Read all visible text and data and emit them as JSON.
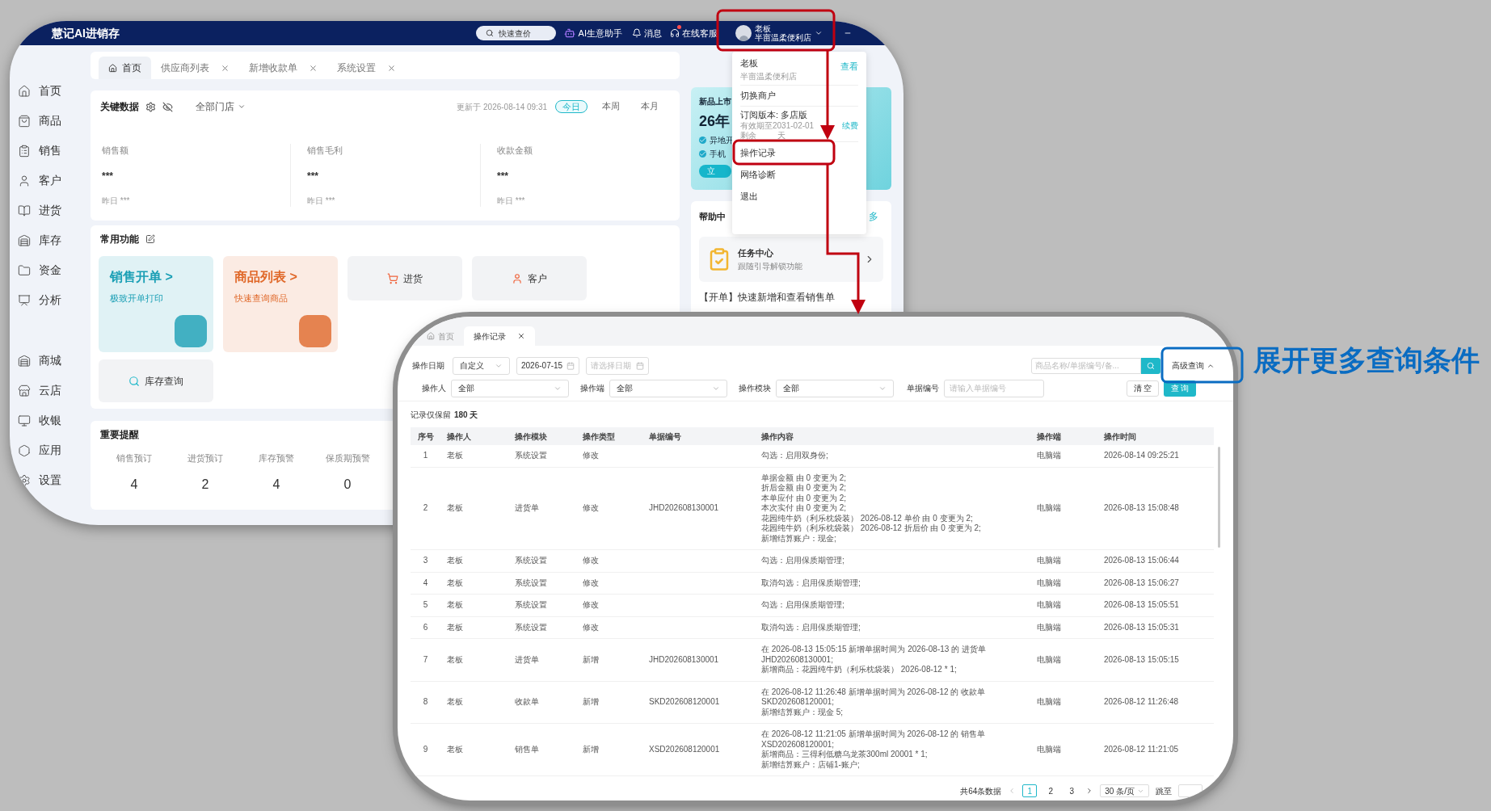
{
  "top_window": {
    "header": {
      "logo": "慧记AI进销存",
      "quick_price": "快速查价",
      "ai_assistant": "AI生意助手",
      "messages": "消息",
      "support": "在线客服",
      "support_notice": true,
      "user_name": "老板",
      "user_shop": "半亩温柔便利店"
    },
    "sidebar_main": [
      {
        "label": "首页"
      },
      {
        "label": "商品"
      },
      {
        "label": "销售"
      },
      {
        "label": "客户"
      },
      {
        "label": "进货"
      },
      {
        "label": "库存"
      },
      {
        "label": "资金"
      },
      {
        "label": "分析"
      }
    ],
    "sidebar_more": [
      {
        "label": "商城"
      },
      {
        "label": "云店"
      },
      {
        "label": "收银"
      },
      {
        "label": "应用"
      },
      {
        "label": "设置"
      }
    ],
    "tabs": [
      {
        "label": "首页",
        "selected": true,
        "closable": false
      },
      {
        "label": "供应商列表",
        "selected": false,
        "closable": true
      },
      {
        "label": "新增收款单",
        "selected": false,
        "closable": true
      },
      {
        "label": "系统设置",
        "selected": false,
        "closable": true
      }
    ],
    "key_data": {
      "title": "关键数据",
      "store": "全部门店",
      "updated": "更新于 2026-08-14 09:31",
      "periods": [
        {
          "label": "今日",
          "selected": true
        },
        {
          "label": "本周",
          "selected": false
        },
        {
          "label": "本月",
          "selected": false
        }
      ],
      "metrics": [
        {
          "label": "销售额",
          "value": "***",
          "yesterday": "昨日 ***"
        },
        {
          "label": "销售毛利",
          "value": "***",
          "yesterday": "昨日 ***"
        },
        {
          "label": "收款金额",
          "value": "***",
          "yesterday": "昨日 ***"
        }
      ]
    },
    "common_functions": {
      "title": "常用功能",
      "features": [
        {
          "kind": "banner",
          "title": "销售开单 >",
          "subtitle": "极致开单打印",
          "color": "#1a9fb5"
        },
        {
          "kind": "banner",
          "title": "商品列表 >",
          "subtitle": "快速查询商品",
          "color": "#e0692a"
        },
        {
          "kind": "tile",
          "label": "进货"
        },
        {
          "kind": "tile",
          "label": "客户"
        },
        {
          "kind": "tile",
          "label": "库存查询"
        }
      ]
    },
    "reminders": {
      "title": "重要提醒",
      "items": [
        {
          "label": "销售预订",
          "count": "4"
        },
        {
          "label": "进货预订",
          "count": "2"
        },
        {
          "label": "库存预警",
          "count": "4"
        },
        {
          "label": "保质期预警",
          "count": "0"
        }
      ]
    },
    "promo": {
      "title": "新品上市",
      "headline": "26年",
      "points": [
        "异地开",
        "手机"
      ],
      "button": "立"
    },
    "help": {
      "title": "帮助中",
      "more": "多",
      "task_title": "任务中心",
      "task_subtitle": "跟随引导解锁功能",
      "article": "【开单】快速新增和查看销售单"
    },
    "user_menu": {
      "name": "老板",
      "shop": "半亩温柔便利店",
      "view": "查看",
      "switch": "切换商户",
      "plan": "订阅版本: 多店版",
      "expiry": "有效期至2031-02-01",
      "renew": "续费",
      "remaining_prefix": "剩余",
      "remaining_suffix": "天",
      "items": [
        "操作记录",
        "网络诊断",
        "退出"
      ]
    }
  },
  "bottom_window": {
    "tabs": [
      {
        "label": "首页",
        "selected": false,
        "closable": false
      },
      {
        "label": "操作记录",
        "selected": true,
        "closable": true
      }
    ],
    "filters": {
      "date_label": "操作日期",
      "date_mode": "自定义",
      "date_start": "2026-07-15",
      "date_end_placeholder": "请选择日期",
      "search_placeholder": "商品名称/单据编号/备...",
      "advanced": "高级查询",
      "advanced_expanded": true,
      "operator_label": "操作人",
      "operator": "全部",
      "terminal_label": "操作端",
      "terminal": "全部",
      "module_label": "操作模块",
      "module": "全部",
      "doc_label": "单据编号",
      "doc_placeholder": "请输入单据编号",
      "clear": "清 空",
      "query": "查 询"
    },
    "note_prefix": "记录仅保留",
    "note_days": "180 天",
    "table": {
      "columns": [
        "序号",
        "操作人",
        "操作模块",
        "操作类型",
        "单据编号",
        "操作内容",
        "操作端",
        "操作时间"
      ],
      "rows": [
        {
          "no": "1",
          "operator": "老板",
          "module": "系统设置",
          "type": "修改",
          "doc": "",
          "content": [
            "勾选：启用双身份;"
          ],
          "terminal": "电脑端",
          "time": "2026-08-14 09:25:21"
        },
        {
          "no": "2",
          "operator": "老板",
          "module": "进货单",
          "type": "修改",
          "doc": "JHD202608130001",
          "content": [
            "单据金额 由 0 变更为 2;",
            "折后金额 由 0 变更为 2;",
            "本单应付 由 0 变更为 2;",
            "本次实付 由 0 变更为 2;",
            "花园纯牛奶（利乐枕袋装） 2026-08-12 单价 由 0 变更为 2;",
            "花园纯牛奶（利乐枕袋装） 2026-08-12 折后价 由 0 变更为 2;",
            "新增结算账户：现金;"
          ],
          "terminal": "电脑端",
          "time": "2026-08-13 15:08:48"
        },
        {
          "no": "3",
          "operator": "老板",
          "module": "系统设置",
          "type": "修改",
          "doc": "",
          "content": [
            "勾选：启用保质期管理;"
          ],
          "terminal": "电脑端",
          "time": "2026-08-13 15:06:44"
        },
        {
          "no": "4",
          "operator": "老板",
          "module": "系统设置",
          "type": "修改",
          "doc": "",
          "content": [
            "取消勾选：启用保质期管理;"
          ],
          "terminal": "电脑端",
          "time": "2026-08-13 15:06:27"
        },
        {
          "no": "5",
          "operator": "老板",
          "module": "系统设置",
          "type": "修改",
          "doc": "",
          "content": [
            "勾选：启用保质期管理;"
          ],
          "terminal": "电脑端",
          "time": "2026-08-13 15:05:51"
        },
        {
          "no": "6",
          "operator": "老板",
          "module": "系统设置",
          "type": "修改",
          "doc": "",
          "content": [
            "取消勾选：启用保质期管理;"
          ],
          "terminal": "电脑端",
          "time": "2026-08-13 15:05:31"
        },
        {
          "no": "7",
          "operator": "老板",
          "module": "进货单",
          "type": "新增",
          "doc": "JHD202608130001",
          "content": [
            "在 2026-08-13 15:05:15 新增单据时间为 2026-08-13 的 进货单 JHD202608130001;",
            "新增商品：花园纯牛奶（利乐枕袋装） 2026-08-12 * 1;"
          ],
          "terminal": "电脑端",
          "time": "2026-08-13 15:05:15"
        },
        {
          "no": "8",
          "operator": "老板",
          "module": "收款单",
          "type": "新增",
          "doc": "SKD202608120001",
          "content": [
            "在 2026-08-12 11:26:48 新增单据时间为 2026-08-12 的 收款单 SKD202608120001;",
            "新增结算账户：现金 5;"
          ],
          "terminal": "电脑端",
          "time": "2026-08-12 11:26:48"
        },
        {
          "no": "9",
          "operator": "老板",
          "module": "销售单",
          "type": "新增",
          "doc": "XSD202608120001",
          "content": [
            "在 2026-08-12 11:21:05 新增单据时间为 2026-08-12 的 销售单 XSD202608120001;",
            "新增商品：三得利低糖乌龙茶300ml 20001 * 1;",
            "新增结算账户：店铺1-账户;"
          ],
          "terminal": "电脑端",
          "time": "2026-08-12 11:21:05"
        }
      ]
    },
    "pagination": {
      "total": "共64条数据",
      "pages": [
        {
          "label": "1",
          "selected": true
        },
        {
          "label": "2",
          "selected": false
        },
        {
          "label": "3",
          "selected": false
        }
      ],
      "page_size": "30 条/页",
      "jump": "跳至"
    }
  },
  "annotations": {
    "callout": "展开更多查询条件"
  }
}
